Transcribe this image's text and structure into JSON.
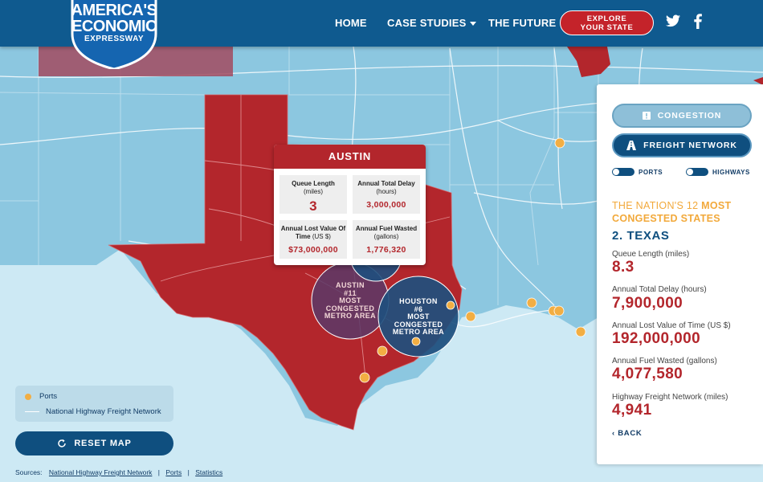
{
  "header": {
    "logo": {
      "line1": "AMERICA'S",
      "line2": "ECONOMIC",
      "line3": "EXPRESSWAY"
    },
    "nav": {
      "home": "HOME",
      "case_studies": "CASE STUDIES",
      "the_future": "THE FUTURE"
    },
    "explore_btn": {
      "line1": "EXPLORE",
      "line2": "YOUR STATE"
    },
    "social": [
      "twitter-icon",
      "facebook-icon"
    ]
  },
  "popup": {
    "title": "AUSTIN",
    "cells": [
      {
        "label": "Queue Length",
        "unit": "(miles)",
        "value": "3"
      },
      {
        "label": "Annual Total Delay",
        "unit": "(hours)",
        "value": "3,000,000"
      },
      {
        "label": "Annual Lost Value Of Time",
        "unit": "(US $)",
        "value": "$73,000,000"
      },
      {
        "label": "Annual Fuel Wasted",
        "unit": "(gallons)",
        "value": "1,776,320"
      }
    ]
  },
  "metros": {
    "austin": {
      "line1": "AUSTIN",
      "line2": "#11",
      "line3": "MOST",
      "line4": "CONGESTED",
      "line5": "METRO AREA"
    },
    "houston": {
      "line1": "HOUSTON",
      "line2": "#6",
      "line3": "MOST",
      "line4": "CONGESTED",
      "line5": "METRO AREA"
    }
  },
  "legend": {
    "ports": "Ports",
    "freight": "National Highway Freight Network"
  },
  "reset_btn": "RESET MAP",
  "sources": {
    "label": "Sources:",
    "links": [
      "National Highway Freight Network",
      "Ports",
      "Statistics"
    ]
  },
  "panel": {
    "congestion_btn": "CONGESTION",
    "freight_btn": "FREIGHT NETWORK",
    "toggle_ports": "PORTS",
    "toggle_highways": "HIGHWAYS",
    "ranking": {
      "part1": "THE NATION'S 12",
      "part2": "MOST CONGESTED STATES"
    },
    "state_title": "2. TEXAS",
    "stats": [
      {
        "label": "Queue Length",
        "unit": "(miles)",
        "value": "8.3"
      },
      {
        "label": "Annual Total Delay",
        "unit": "(hours)",
        "value": "7,900,000"
      },
      {
        "label": "Annual Lost Value of Time",
        "unit": "(US $)",
        "value": "192,000,000"
      },
      {
        "label": "Annual Fuel Wasted",
        "unit": "(gallons)",
        "value": "4,077,580"
      },
      {
        "label": "Highway Freight Network",
        "unit": "(miles)",
        "value": "4,941"
      }
    ],
    "back": "BACK"
  },
  "colors": {
    "navy": "#0f5a8f",
    "red": "#b3262c",
    "orange": "#f2a93b",
    "map_land": "#8cc7e0",
    "gulf": "#cde9f4"
  }
}
